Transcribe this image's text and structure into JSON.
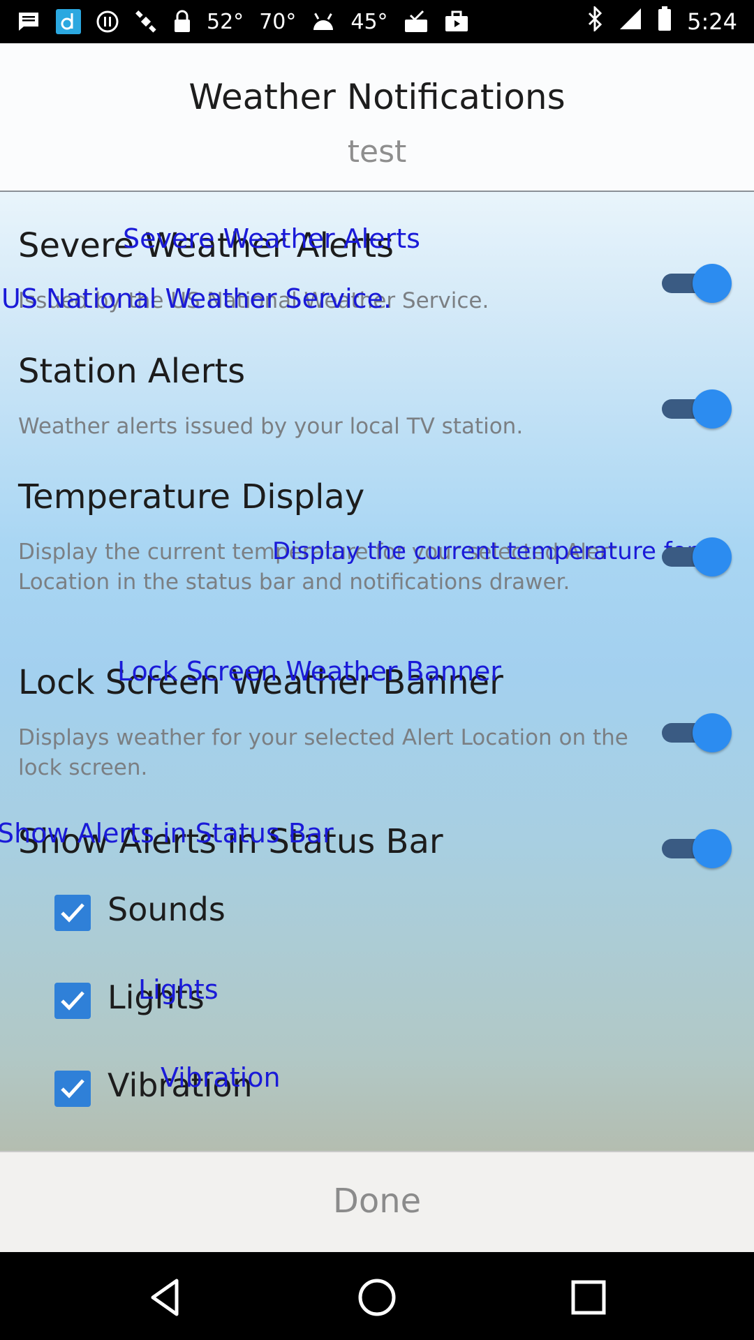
{
  "status_bar": {
    "temps": [
      "52°",
      "70°",
      "45°"
    ],
    "time": "5:24"
  },
  "header": {
    "title": "Weather Notifications",
    "subtitle": "test"
  },
  "settings": [
    {
      "title": "Severe Weather Alerts",
      "description": "Issued by the US National Weather Service.",
      "enabled": true,
      "overlay_title": "Severe Weather Alerts",
      "overlay_desc": "US National Weather Service."
    },
    {
      "title": "Station Alerts",
      "description": "Weather alerts issued by your local TV station.",
      "enabled": true
    },
    {
      "title": "Temperature Display",
      "description": "Display the current temperature for your selected Alert Location in the status bar and notifications drawer.",
      "enabled": true,
      "overlay_desc": "Display the current temperature for"
    },
    {
      "title": "Lock Screen Weather Banner",
      "description": "Displays weather for your selected Alert Location on the lock screen.",
      "enabled": true,
      "overlay_title": "Lock Screen Weather Banner"
    },
    {
      "title": "Show Alerts in Status Bar",
      "enabled": true,
      "overlay_title": "Show Alerts in Status Bar"
    }
  ],
  "options": [
    {
      "label": "Sounds",
      "checked": true
    },
    {
      "label": "Lights",
      "checked": true,
      "overlay": "Lights"
    },
    {
      "label": "Vibration",
      "checked": true,
      "overlay": "Vibration"
    }
  ],
  "done_label": "Done",
  "colors": {
    "toggle_thumb": "#2c8cf0",
    "toggle_track": "#3a5b83",
    "checkbox": "#2f80d8",
    "overlay_text": "#1a1ad8"
  }
}
